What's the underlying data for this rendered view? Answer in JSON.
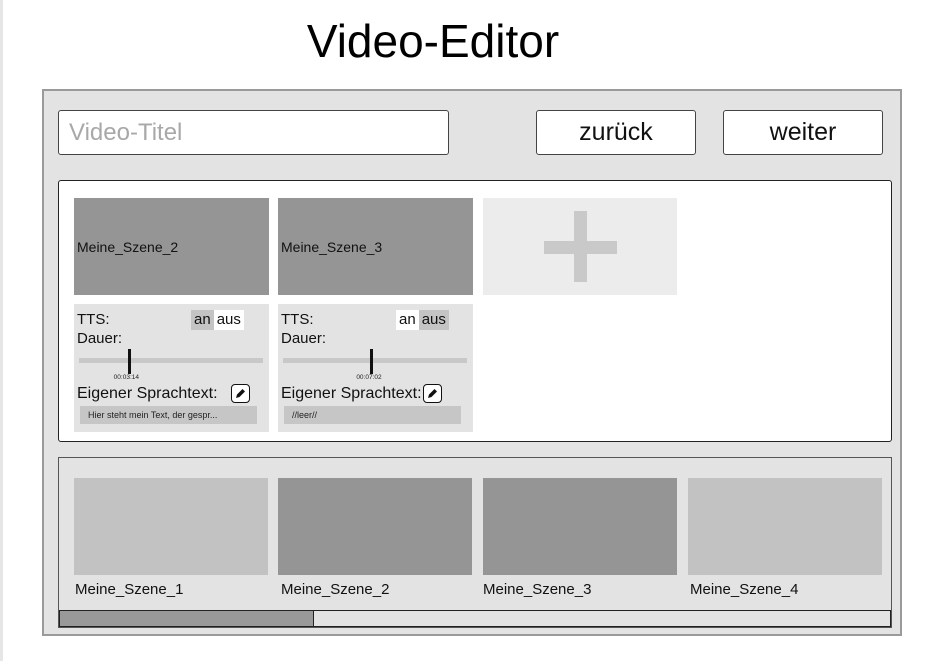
{
  "page": {
    "title": "Video-Editor"
  },
  "toolbar": {
    "title_placeholder": "Video-Titel",
    "title_value": "",
    "back_label": "zurück",
    "next_label": "weiter"
  },
  "editor": {
    "scenes": [
      {
        "name": "Meine_Szene_2",
        "tts_label": "TTS:",
        "tts_on": "an",
        "tts_off": "aus",
        "tts_state": "aus",
        "duration_label": "Dauer:",
        "duration_value": "00:03:14",
        "duration_fraction": 0.27,
        "speech_label": "Eigener Sprachtext:",
        "speech_text": "Hier steht mein Text, der gespr..."
      },
      {
        "name": "Meine_Szene_3",
        "tts_label": "TTS:",
        "tts_on": "an",
        "tts_off": "aus",
        "tts_state": "an",
        "duration_label": "Dauer:",
        "duration_value": "00:07:02",
        "duration_fraction": 0.48,
        "speech_label": "Eigener Sprachtext:",
        "speech_text": "//leer//"
      }
    ],
    "add_icon": "plus-icon",
    "edit_icon": "pencil-icon"
  },
  "timeline": {
    "scenes": [
      {
        "name": "Meine_Szene_1",
        "color": "#c2c2c2"
      },
      {
        "name": "Meine_Szene_2",
        "color": "#959595"
      },
      {
        "name": "Meine_Szene_3",
        "color": "#959595"
      },
      {
        "name": "Meine_Szene_4",
        "color": "#c2c2c2"
      }
    ],
    "scroll_fraction": 0.3
  },
  "colors": {
    "frame_bg": "#e3e3e3",
    "active_scene": "#959595",
    "inactive_scene": "#c2c2c2",
    "toggle_active": "#ffffff",
    "toggle_inactive": "#c4c4c4"
  }
}
